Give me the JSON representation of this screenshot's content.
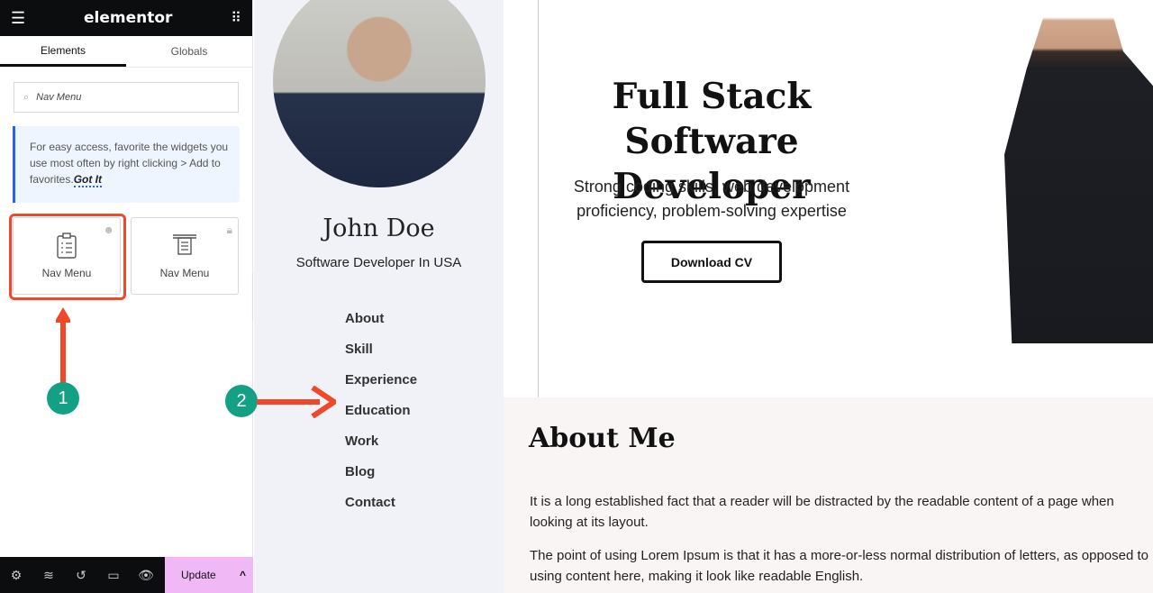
{
  "sidebar": {
    "logo": "elementor",
    "tabs": [
      "Elements",
      "Globals"
    ],
    "search_value": "Nav Menu",
    "tip": {
      "text": "For easy access, favorite the widgets you use most often by right clicking > Add to favorites.",
      "link": "Got It"
    },
    "widgets": [
      {
        "label": "Nav Menu",
        "icon": "clipboard-list-icon",
        "badge": "pro-icon"
      },
      {
        "label": "Nav Menu",
        "icon": "nav-menu-icon",
        "badge": "lock-icon"
      }
    ],
    "bottom": {
      "update_label": "Update"
    }
  },
  "annotations": {
    "step1": "1",
    "step2": "2",
    "color": "#f0492a",
    "badge_color": "#14a085"
  },
  "profile": {
    "name": "John Doe",
    "subtitle": "Software Developer In USA",
    "nav": [
      "About",
      "Skill",
      "Experience",
      "Education",
      "Work",
      "Blog",
      "Contact"
    ]
  },
  "hero": {
    "title": "Full Stack Software Developer",
    "subtitle": "Strong coding skills, web development proficiency, problem-solving expertise",
    "cv_button": "Download CV"
  },
  "about": {
    "title": "About Me",
    "p1": "It is a long established fact that a reader will be distracted by the readable content of a page when looking at its layout.",
    "p2": "The point of using Lorem Ipsum is that it has a more-or-less normal distribution of letters, as opposed to using content here, making it look like readable English."
  }
}
